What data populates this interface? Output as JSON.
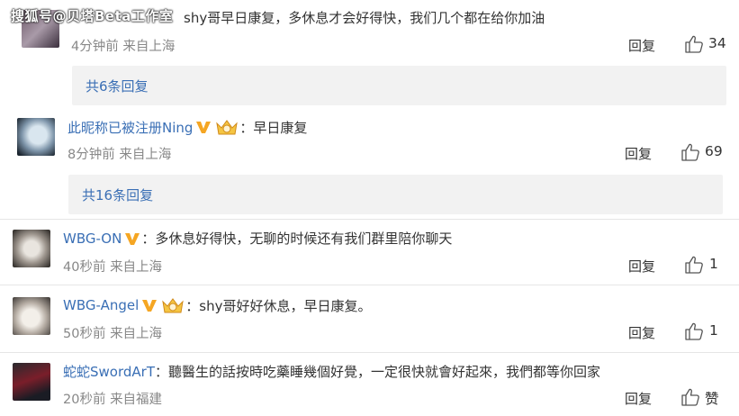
{
  "watermark": "搜狐号@贝塔Beta工作室",
  "comments": [
    {
      "text": "shy哥早日康复，多休息才会好得快，我们几个都在给你加油",
      "time": "4分钟前",
      "location": "来自上海",
      "reply_label": "回复",
      "likes": "34",
      "sub_replies": "共6条回复"
    },
    {
      "username": "此昵称已被注册Ning",
      "text": "：早日康复",
      "time": "8分钟前",
      "location": "来自上海",
      "reply_label": "回复",
      "likes": "69",
      "sub_replies": "共16条回复"
    },
    {
      "username": "WBG-ON",
      "text": "：多休息好得快，无聊的时候还有我们群里陪你聊天",
      "time": "40秒前",
      "location": "来自上海",
      "reply_label": "回复",
      "likes": "1"
    },
    {
      "username": "WBG-Angel",
      "text": "：shy哥好好休息，早日康复。",
      "time": "50秒前",
      "location": "来自上海",
      "reply_label": "回复",
      "likes": "1"
    },
    {
      "username": "蛇蛇SwordArT",
      "text": "：聽醫生的話按時吃藥睡幾個好覺，一定很快就會好起來，我們都等你回家",
      "time": "20秒前",
      "location": "来自福建",
      "reply_label": "回复",
      "likes": "赞"
    }
  ],
  "colors": {
    "link": "#3a6fb5",
    "vip_badge": "#f5a623",
    "sub_box": "#f2f2f2"
  },
  "icons": {
    "like": "thumbs-up-icon",
    "vip": "v-badge-icon",
    "fan": "crown-badge-icon"
  }
}
